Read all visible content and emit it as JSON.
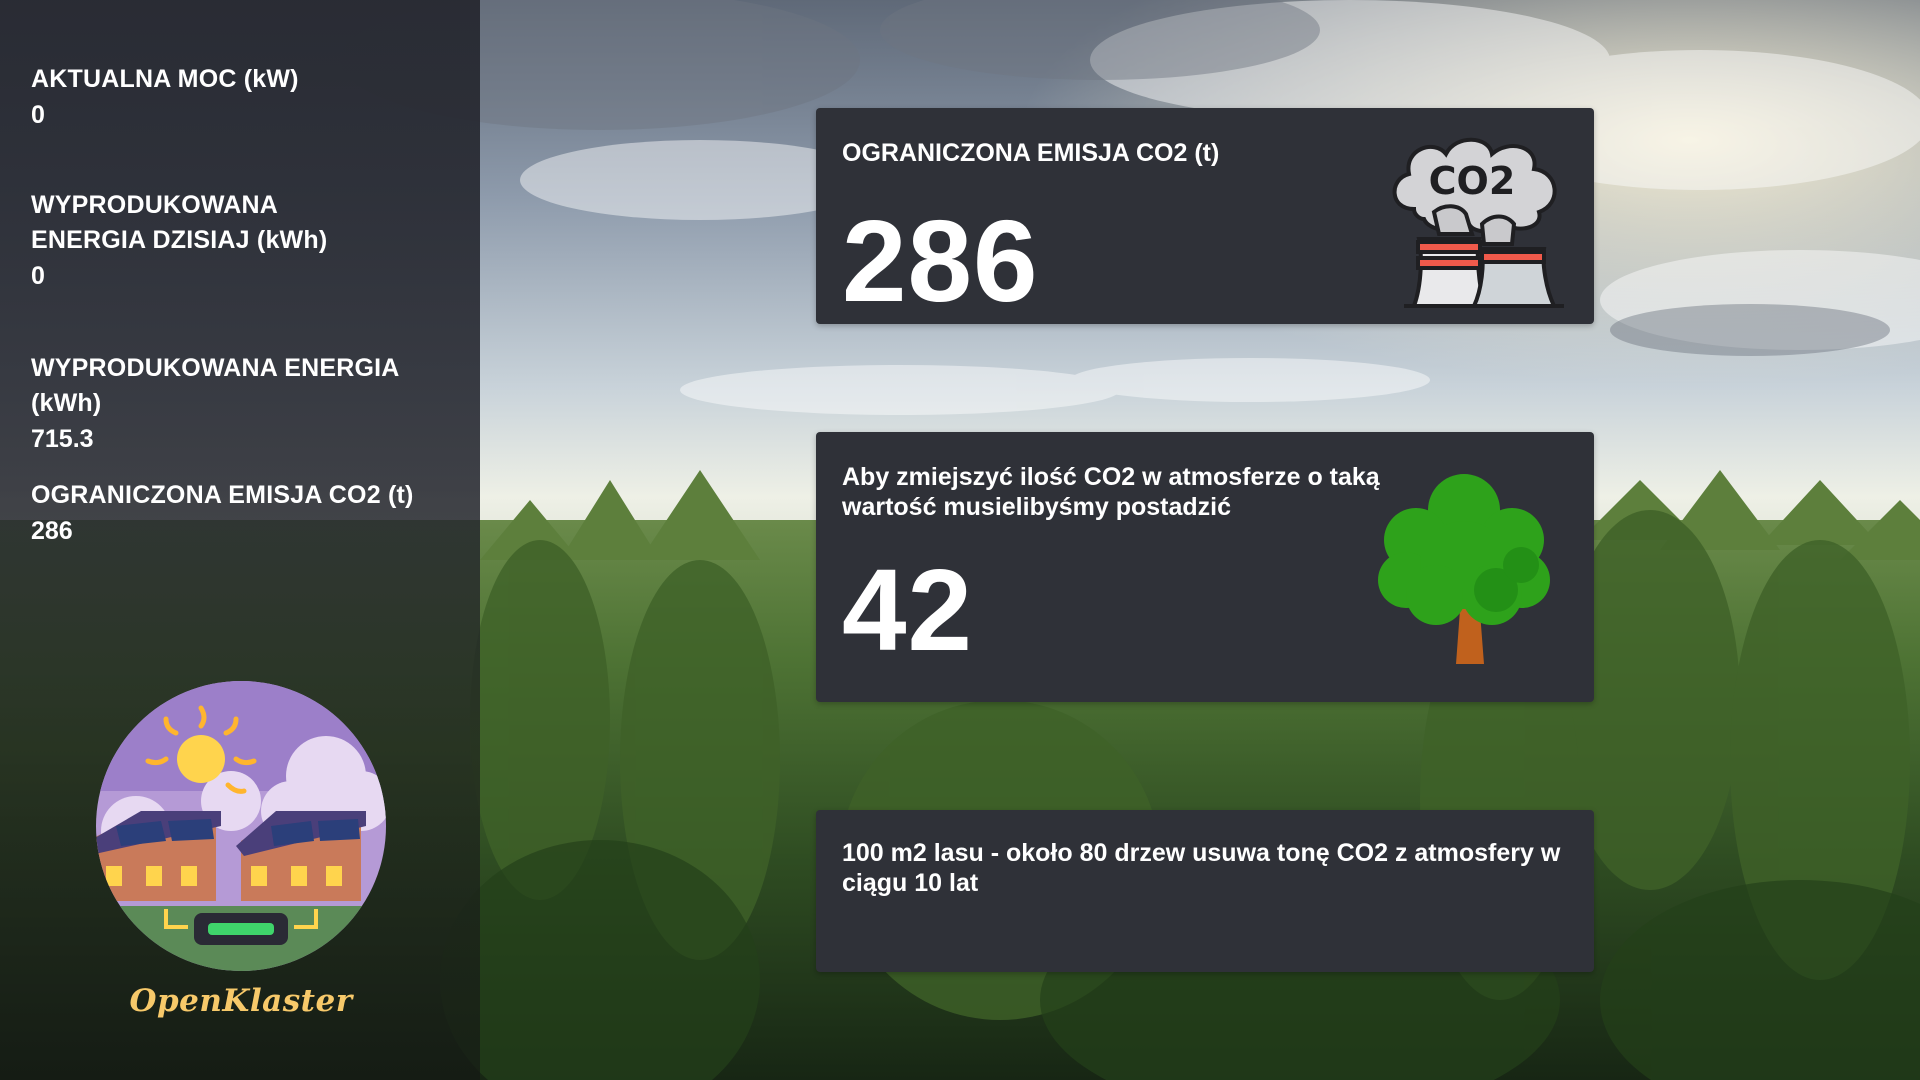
{
  "sidebar": {
    "stats": [
      {
        "label": "AKTUALNA MOC (kW)",
        "value": "0"
      },
      {
        "label": "WYPRODUKOWANA ENERGIA DZISIAJ (kWh)",
        "value": "0"
      },
      {
        "label": "WYPRODUKOWANA ENERGIA (kWh)",
        "value": "715.3"
      },
      {
        "label": "OGRANICZONA EMISJA CO2 (t)",
        "value": "286"
      }
    ],
    "logo": {
      "brand": "OpenKlaster",
      "icon": "solar-houses-battery-icon"
    }
  },
  "cards": {
    "emission": {
      "title": "OGRANICZONA EMISJA CO2 (t)",
      "value": "286",
      "icon": "co2-factory-icon",
      "icon_text": "CO2"
    },
    "trees": {
      "title": "Aby zmiejszyć ilość CO2 w atmosferze o taką wartość musielibyśmy postadzić",
      "value": "42",
      "icon": "tree-icon"
    },
    "info": {
      "text": "100 m2 lasu - około 80 drzew usuwa tonę CO2 z atmosfery w ciągu 10 lat"
    }
  },
  "colors": {
    "card_bg": "#2f3138",
    "sidebar_bg": "#26282f",
    "brand_text": "#f7c96a",
    "tree_green": "#2ea21b",
    "trunk": "#c0611d"
  }
}
